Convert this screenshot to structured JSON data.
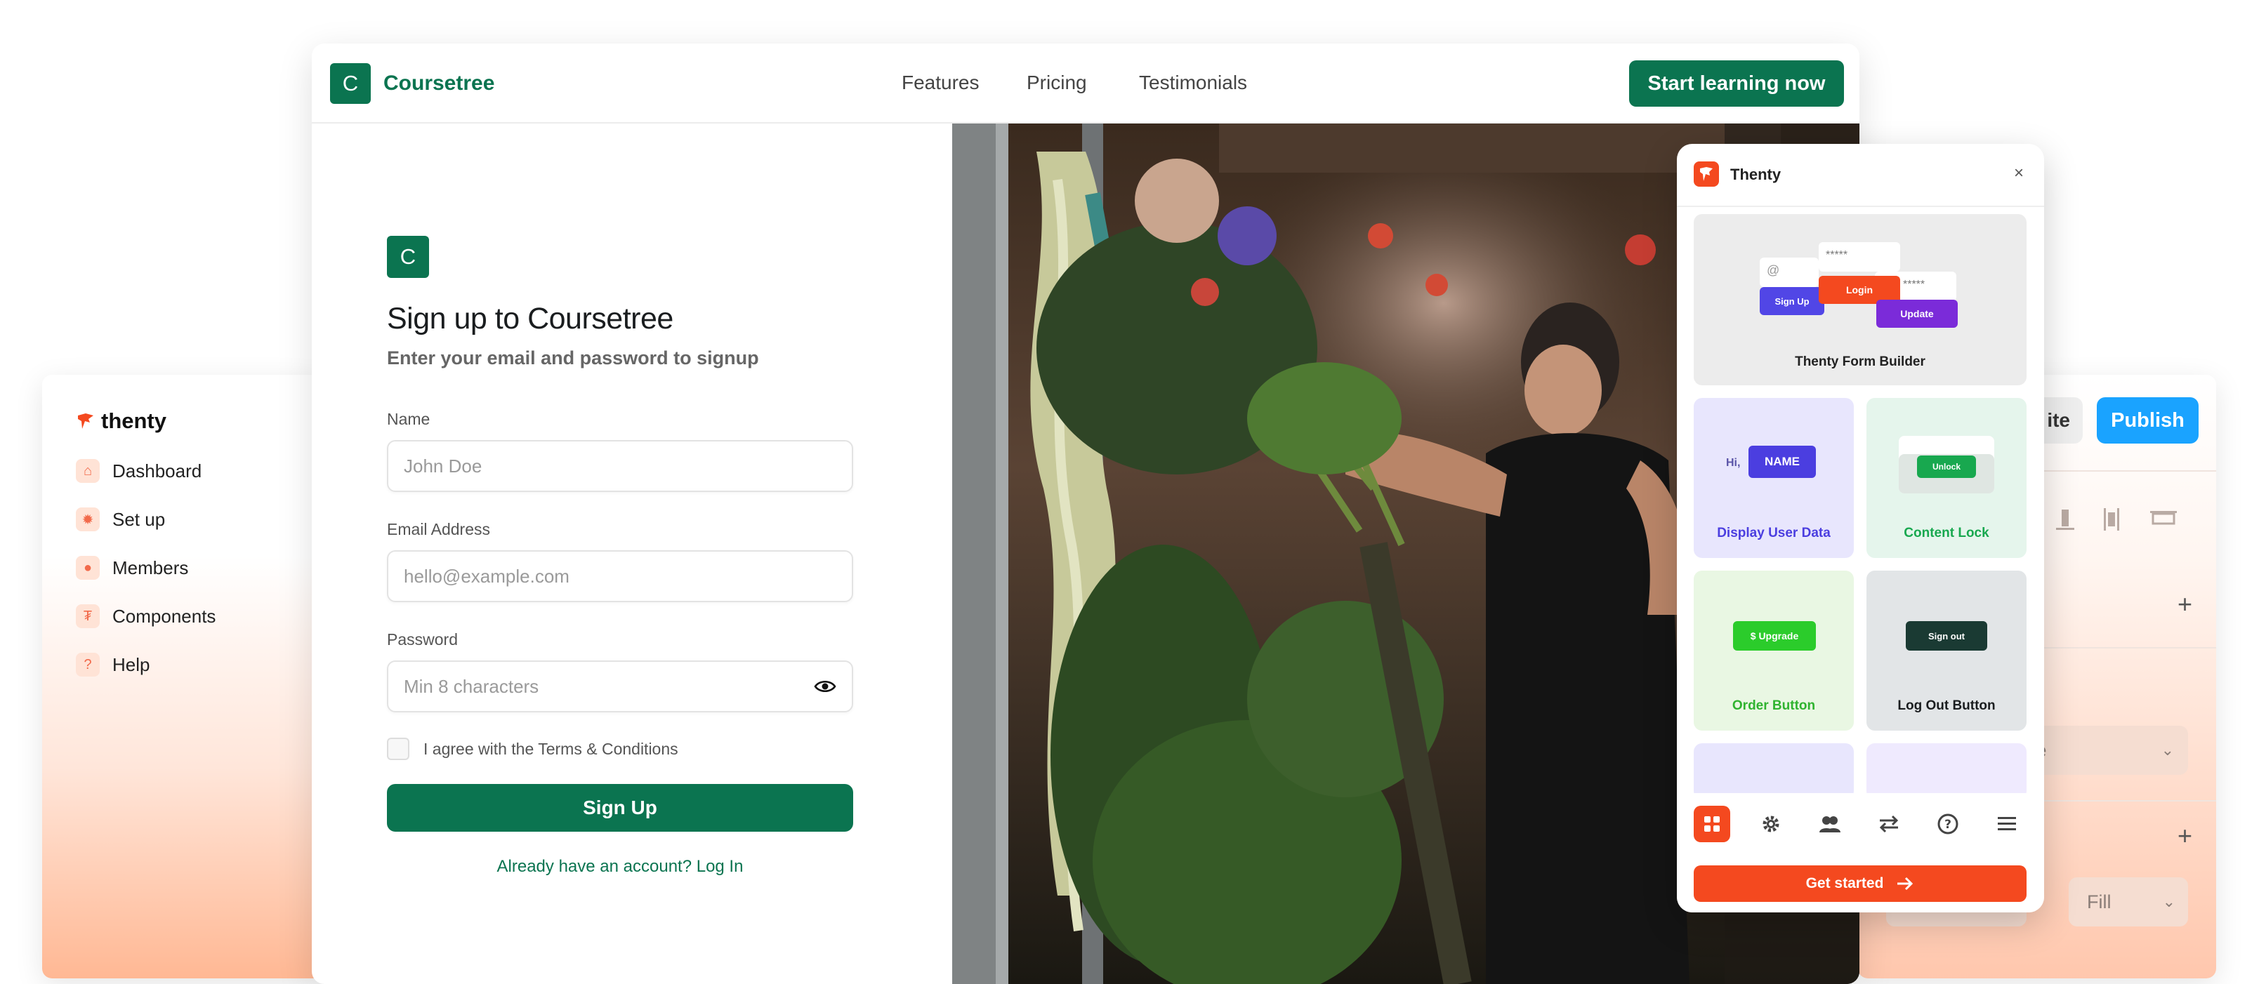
{
  "dashboard": {
    "brand": "thenty",
    "nav": [
      {
        "label": "Dashboard",
        "icon": "home-icon"
      },
      {
        "label": "Set up",
        "icon": "gear-icon"
      },
      {
        "label": "Members",
        "icon": "user-icon"
      },
      {
        "label": "Components",
        "icon": "thenty-icon"
      },
      {
        "label": "Help",
        "icon": "question-icon"
      }
    ],
    "accent": "#f26a4b"
  },
  "editor": {
    "ghost_button": "ite",
    "publish_label": "Publish",
    "select_value": "ve",
    "fill_label": "Fill",
    "accent": "#1aa3ff"
  },
  "site": {
    "brand_initial": "C",
    "brand_name": "Coursetree",
    "nav": [
      "Features",
      "Pricing",
      "Testimonials"
    ],
    "cta_label": "Start learning now",
    "brand_color": "#0b7450",
    "form": {
      "title": "Sign up to Coursetree",
      "subtitle": "Enter your email and password to signup",
      "name_label": "Name",
      "name_placeholder": "John Doe",
      "email_label": "Email Address",
      "email_placeholder": "hello@example.com",
      "password_label": "Password",
      "password_placeholder": "Min 8 characters",
      "agree_label": "I agree with the Terms & Conditions",
      "submit_label": "Sign Up",
      "login_link": "Already have an account? Log In"
    }
  },
  "popup": {
    "title": "Thenty",
    "close": "×",
    "cards": [
      {
        "label": "Thenty Form Builder"
      },
      {
        "label": "Display User Data",
        "greeting": "Hi,",
        "chip": "NAME"
      },
      {
        "label": "Content Lock",
        "chip": "Unlock"
      },
      {
        "label": "Order Button",
        "chip": "$ Upgrade"
      },
      {
        "label": "Log Out Button",
        "chip": "Sign out"
      }
    ],
    "form_builder": {
      "at": "@",
      "stars1": "*****",
      "stars2": "*****",
      "signup": "Sign Up",
      "login": "Login",
      "update": "Update"
    },
    "footer_icons": [
      "grid-icon",
      "gear-icon",
      "users-icon",
      "swap-icon",
      "help-icon",
      "menu-icon"
    ],
    "get_started_label": "Get started",
    "accent": "#f4491f"
  }
}
